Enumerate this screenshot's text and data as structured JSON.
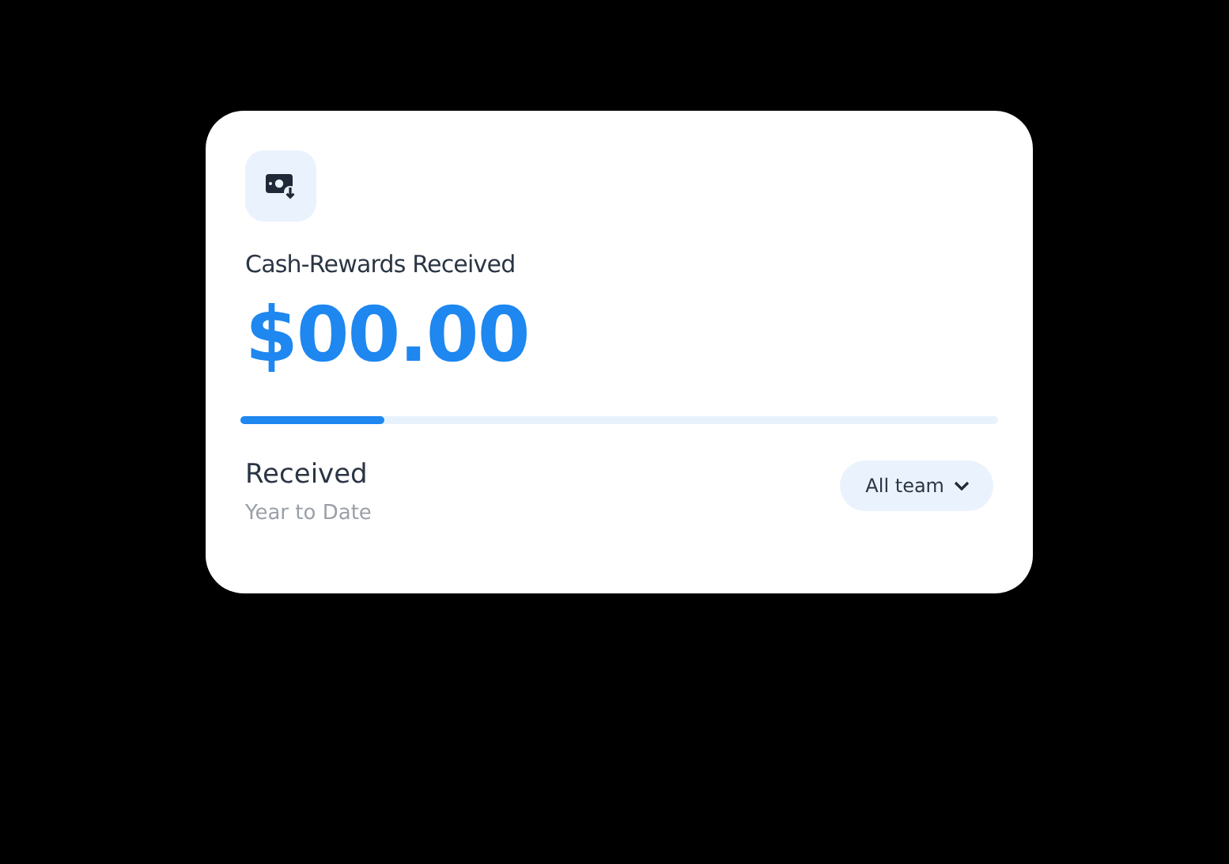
{
  "card": {
    "title": "Cash-Rewards Received",
    "amount": "$00.00",
    "progress": {
      "level": 0.19
    },
    "label": "Received",
    "sublabel": "Year to Date",
    "filter": {
      "label": "All team"
    }
  }
}
